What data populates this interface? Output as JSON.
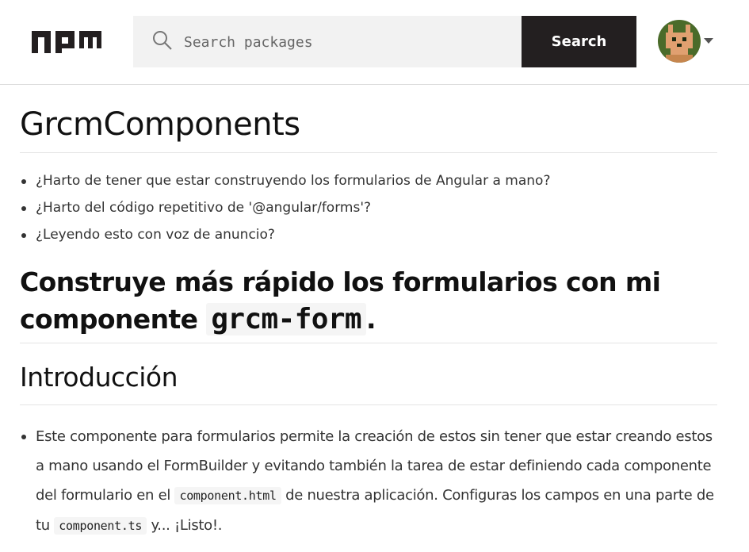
{
  "header": {
    "logo_label": "npm",
    "search": {
      "placeholder": "Search packages",
      "value": ""
    },
    "search_button_label": "Search",
    "avatar_icon": "pixel-fox-avatar",
    "menu_icon": "caret-down-icon"
  },
  "package": {
    "title": "GrcmComponents",
    "bullets": [
      "¿Harto de tener que estar construyendo los formularios de Angular a mano?",
      "¿Harto del código repetitivo de '@angular/forms'?",
      "¿Leyendo esto con voz de anuncio?"
    ],
    "heading": {
      "text": "Construye más rápido los formularios con mi componente",
      "code": "grcm-form",
      "suffix": "."
    },
    "intro": {
      "heading": "Introducción",
      "paragraph": {
        "part1": "Este componente para formularios permite la creación de estos sin tener que estar creando estos a mano usando el FormBuilder y evitando también la tarea de estar definiendo cada componente del formulario en el",
        "code1": "component.html",
        "part2": "de nuestra aplicación. Configuras los campos en una parte de tu",
        "code2": "component.ts",
        "part3": "y... ¡Listo!."
      }
    }
  },
  "colors": {
    "header_button_bg": "#231f20",
    "search_bg": "#f2f2f2",
    "avatar_bg": "#4a6b2a",
    "avatar_fox": "#e0a070"
  }
}
